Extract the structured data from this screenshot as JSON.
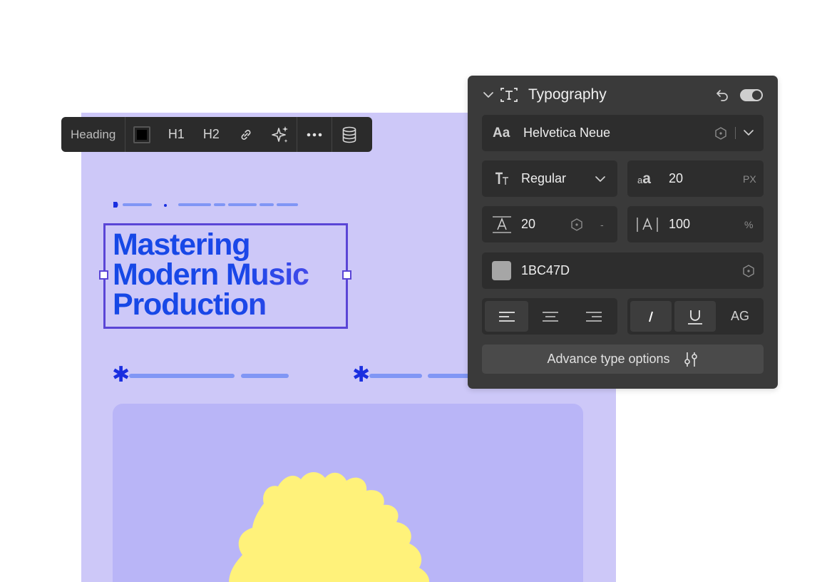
{
  "canvas": {
    "background_color": "#cdc8f8",
    "heading": {
      "text": "Mastering\nModern Music\nProduction",
      "color_start": "#1648e6",
      "color_end": "#5a4bea"
    },
    "asterisk_glyph": "✱",
    "image_card_color": "#b9b5f7",
    "sun_color": "#fff27a"
  },
  "toolbar": {
    "element_label": "Heading",
    "h1_label": "H1",
    "h2_label": "H2",
    "icons": [
      "color-swatch",
      "link-icon",
      "sparkle-icon",
      "more-icon",
      "database-icon"
    ]
  },
  "typography_panel": {
    "title": "Typography",
    "font_family": {
      "icon_text": "Aa",
      "value": "Helvetica Neue"
    },
    "font_weight": {
      "value": "Regular"
    },
    "font_size": {
      "value": "20",
      "unit": "PX"
    },
    "line_height": {
      "value": "20",
      "unit": "-"
    },
    "letter_spacing": {
      "value": "100",
      "unit": "%"
    },
    "color": {
      "value": "1BC47D",
      "swatch_color": "#a6a6a6"
    },
    "alignment": [
      "left",
      "center",
      "right"
    ],
    "alignment_selected": "left",
    "style_buttons": {
      "case_label": "AG"
    },
    "advanced_button": "Advance type options",
    "toggle_on": true
  }
}
